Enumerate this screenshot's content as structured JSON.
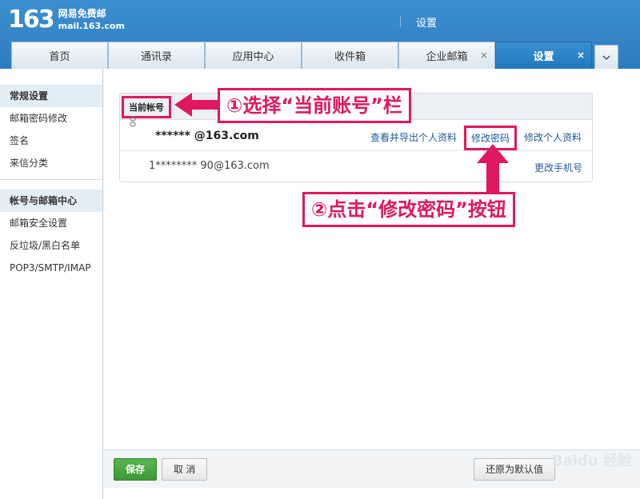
{
  "header": {
    "logo_number": "163",
    "logo_cn": "网易免费邮",
    "logo_domain": "mail.163.com",
    "title": "设置"
  },
  "tabs": [
    {
      "label": "首页"
    },
    {
      "label": "通讯录"
    },
    {
      "label": "应用中心"
    },
    {
      "label": "收件箱"
    },
    {
      "label": "企业邮箱",
      "close": "×"
    },
    {
      "label": "设置",
      "close": "×"
    }
  ],
  "sidebar": {
    "group1_title": "常规设置",
    "group1_items": [
      "邮箱密码修改",
      "签名",
      "来信分类"
    ],
    "group2_title": "帐号与邮箱中心",
    "group2_items": [
      "邮箱安全设置",
      "反垃圾/黑白名单",
      "POP3/SMTP/IMAP"
    ]
  },
  "panel": {
    "section_label": "当前帐号",
    "email": "****** @163.com",
    "link_export": "查看并导出个人资料",
    "link_password": "修改密码",
    "link_profile": "修改个人资料",
    "phone": "1******** 90@163.com",
    "link_phone": "更改手机号"
  },
  "annotations": {
    "step1": "①选择“当前账号”栏",
    "step2": "②点击“修改密码”按钮",
    "accent_color": "#e0185f"
  },
  "footer": {
    "save": "保存",
    "cancel": "取 消",
    "reset": "还原为默认值"
  },
  "watermark": "Baidu 经验"
}
